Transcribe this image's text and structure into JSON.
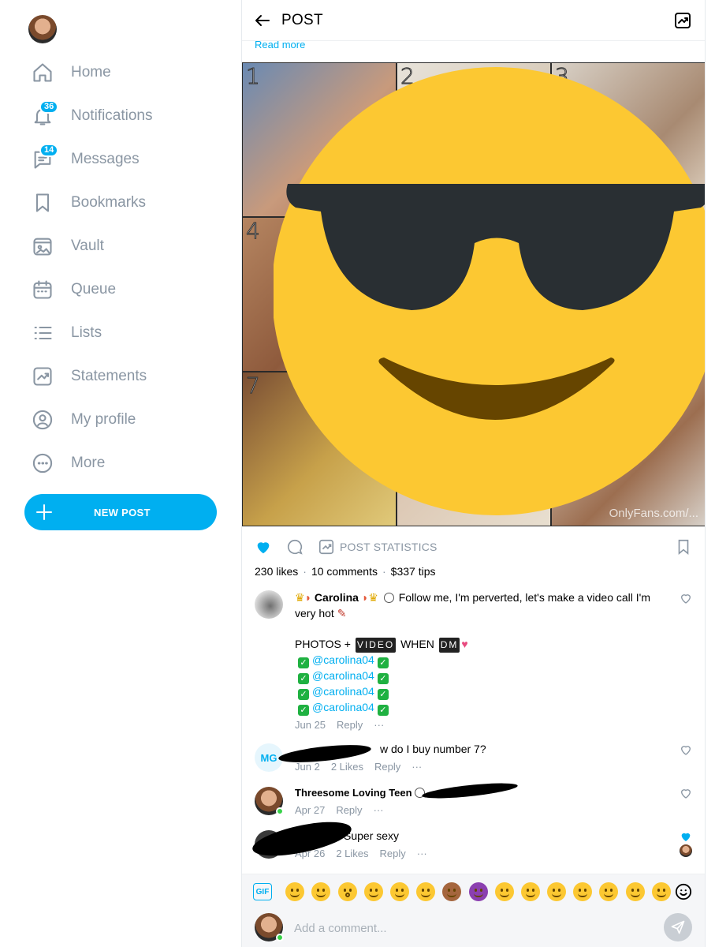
{
  "sidebar": {
    "items": [
      {
        "label": "Home",
        "icon": "home-icon"
      },
      {
        "label": "Notifications",
        "icon": "bell-icon",
        "badge": "36"
      },
      {
        "label": "Messages",
        "icon": "message-icon",
        "badge": "14"
      },
      {
        "label": "Bookmarks",
        "icon": "bookmark-icon"
      },
      {
        "label": "Vault",
        "icon": "vault-icon"
      },
      {
        "label": "Queue",
        "icon": "calendar-icon"
      },
      {
        "label": "Lists",
        "icon": "list-icon"
      },
      {
        "label": "Statements",
        "icon": "statements-icon"
      },
      {
        "label": "My profile",
        "icon": "profile-icon"
      },
      {
        "label": "More",
        "icon": "more-icon"
      }
    ],
    "new_post_label": "NEW POST"
  },
  "header": {
    "title": "POST",
    "read_more": "Read more"
  },
  "media": {
    "tile_numbers": [
      "1",
      "2",
      "3",
      "4",
      "7"
    ],
    "watermark": "OnlyFans.com/..."
  },
  "actions": {
    "post_statistics_label": "POST STATISTICS"
  },
  "stats": {
    "likes": "230 likes",
    "comments": "10 comments",
    "tips": "$337 tips"
  },
  "comments": [
    {
      "name": "Carolina",
      "text_1": "Follow me, I'm perverted, let's make a video call I'm very hot",
      "text_2a": "PHOTOS +",
      "text_2b": "VIDEO",
      "text_2c": "WHEN",
      "text_2d": "DM",
      "mentions": [
        "@carolina04",
        "@carolina04",
        "@carolina04",
        "@carolina04"
      ],
      "date": "Jun 25",
      "reply": "Reply",
      "more": "···"
    },
    {
      "initials": "MG",
      "text": "w do I buy number 7?",
      "date": "Jun 2",
      "likes": "2 Likes",
      "reply": "Reply",
      "more": "···"
    },
    {
      "name": "Threesome Loving Teen",
      "date": "Apr 27",
      "reply": "Reply",
      "more": "···"
    },
    {
      "text": "Super sexy",
      "date": "Apr 26",
      "likes": "2 Likes",
      "reply": "Reply",
      "more": "···"
    }
  ],
  "emoji_bar": {
    "gif_label": "GIF",
    "emojis": [
      "tired-face",
      "weary-face",
      "hushed-face",
      "kissing-face",
      "tongue-wink-face",
      "sunglasses-face",
      "see-no-evil-monkey",
      "smiling-devil",
      "grinning-face",
      "beaming-face",
      "tears-of-joy-face",
      "big-smile-face",
      "grin-face",
      "sweat-smile-face",
      "squinting-face"
    ]
  },
  "compose": {
    "placeholder": "Add a comment..."
  },
  "colors": {
    "accent": "#00aff0",
    "muted": "#8a96a3",
    "emoji_yellow": "#fcc832"
  }
}
